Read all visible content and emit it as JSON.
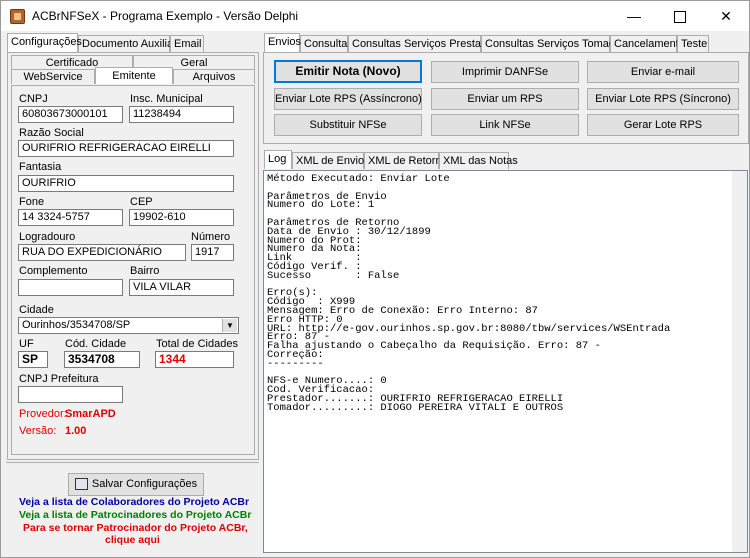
{
  "window": {
    "title": "ACBrNFSeX - Programa Exemplo - Versão Delphi",
    "minimize": "—",
    "close": "✕"
  },
  "left_tabs": [
    "Configurações",
    "Documento Auxiliar",
    "Email"
  ],
  "sub_tabs_row1": [
    "Certificado",
    "Geral"
  ],
  "sub_tabs_row2": [
    "WebService",
    "Emitente",
    "Arquivos"
  ],
  "emitente": {
    "cnpj_label": "CNPJ",
    "cnpj": "60803673000101",
    "im_label": "Insc. Municipal",
    "im": "11238494",
    "razao_label": "Razão Social",
    "razao": "OURIFRIO REFRIGERACAO EIRELLI",
    "fantasia_label": "Fantasia",
    "fantasia": "OURIFRIO",
    "fone_label": "Fone",
    "fone": "14 3324-5757",
    "cep_label": "CEP",
    "cep": "19902-610",
    "logradouro_label": "Logradouro",
    "logradouro": "RUA DO EXPEDICIONÁRIO",
    "numero_label": "Número",
    "numero": "1917",
    "complemento_label": "Complemento",
    "complemento": "",
    "bairro_label": "Bairro",
    "bairro": "VILA VILAR",
    "cidade_label": "Cidade",
    "cidade": "Ourinhos/3534708/SP",
    "uf_label": "UF",
    "uf": "SP",
    "cod_cidade_label": "Cód. Cidade",
    "cod_cidade": "3534708",
    "total_cidades_label": "Total de Cidades",
    "total_cidades": "1344",
    "cnpj_prefeitura_label": "CNPJ Prefeitura",
    "cnpj_prefeitura": "",
    "provedor_label": "Provedor:",
    "provedor": "SmarAPD",
    "versao_label": "Versão:",
    "versao": "1.00"
  },
  "salvar_label": "Salvar Configurações",
  "links": {
    "colaboradores": "Veja a lista de Colaboradores do Projeto ACBr",
    "patrocinadores": "Veja a lista de Patrocinadores do Projeto ACBr",
    "patrocinador1": "Para se tornar Patrocinador do Projeto ACBr,",
    "patrocinador2": "clique aqui"
  },
  "right_tabs": [
    "Envios",
    "Consultas",
    "Consultas Serviços Prestados",
    "Consultas Serviços Tomados",
    "Cancelamento",
    "Teste"
  ],
  "buttons": [
    "Emitir Nota (Novo)",
    "Imprimir DANFSe",
    "Enviar e-mail",
    "Enviar Lote RPS (Assíncrono)",
    "Enviar um RPS",
    "Enviar Lote RPS (Síncrono)",
    "Substituir NFSe",
    "Link NFSe",
    "Gerar Lote RPS"
  ],
  "log_tabs": [
    "Log",
    "XML de Envio",
    "XML de Retorno",
    "XML das Notas"
  ],
  "log_lines": [
    "Método Executado: Enviar Lote",
    "",
    "Parâmetros de Envio",
    "Numero do Lote: 1",
    "",
    "Parâmetros de Retorno",
    "Data de Envio : 30/12/1899",
    "Numero do Prot:",
    "Numero da Nota:",
    "Link          :",
    "Código Verif. :",
    "Sucesso       : False",
    "",
    "Erro(s):",
    "Código  : X999",
    "Mensagem: Erro de Conexão: Erro Interno: 87",
    "Erro HTTP: 0",
    "URL: http://e-gov.ourinhos.sp.gov.br:8080/tbw/services/WSEntrada",
    "Erro: 87 -",
    "Falha ajustando o Cabeçalho da Requisição. Erro: 87 -",
    "Correção:",
    "---------",
    "",
    "NFS-e Numero....: 0",
    "Cod. Verificacao:",
    "Prestador.......: OURIFRIO REFRIGERACAO EIRELLI",
    "Tomador.........: DIOGO PEREIRA VITALI E OUTROS"
  ]
}
